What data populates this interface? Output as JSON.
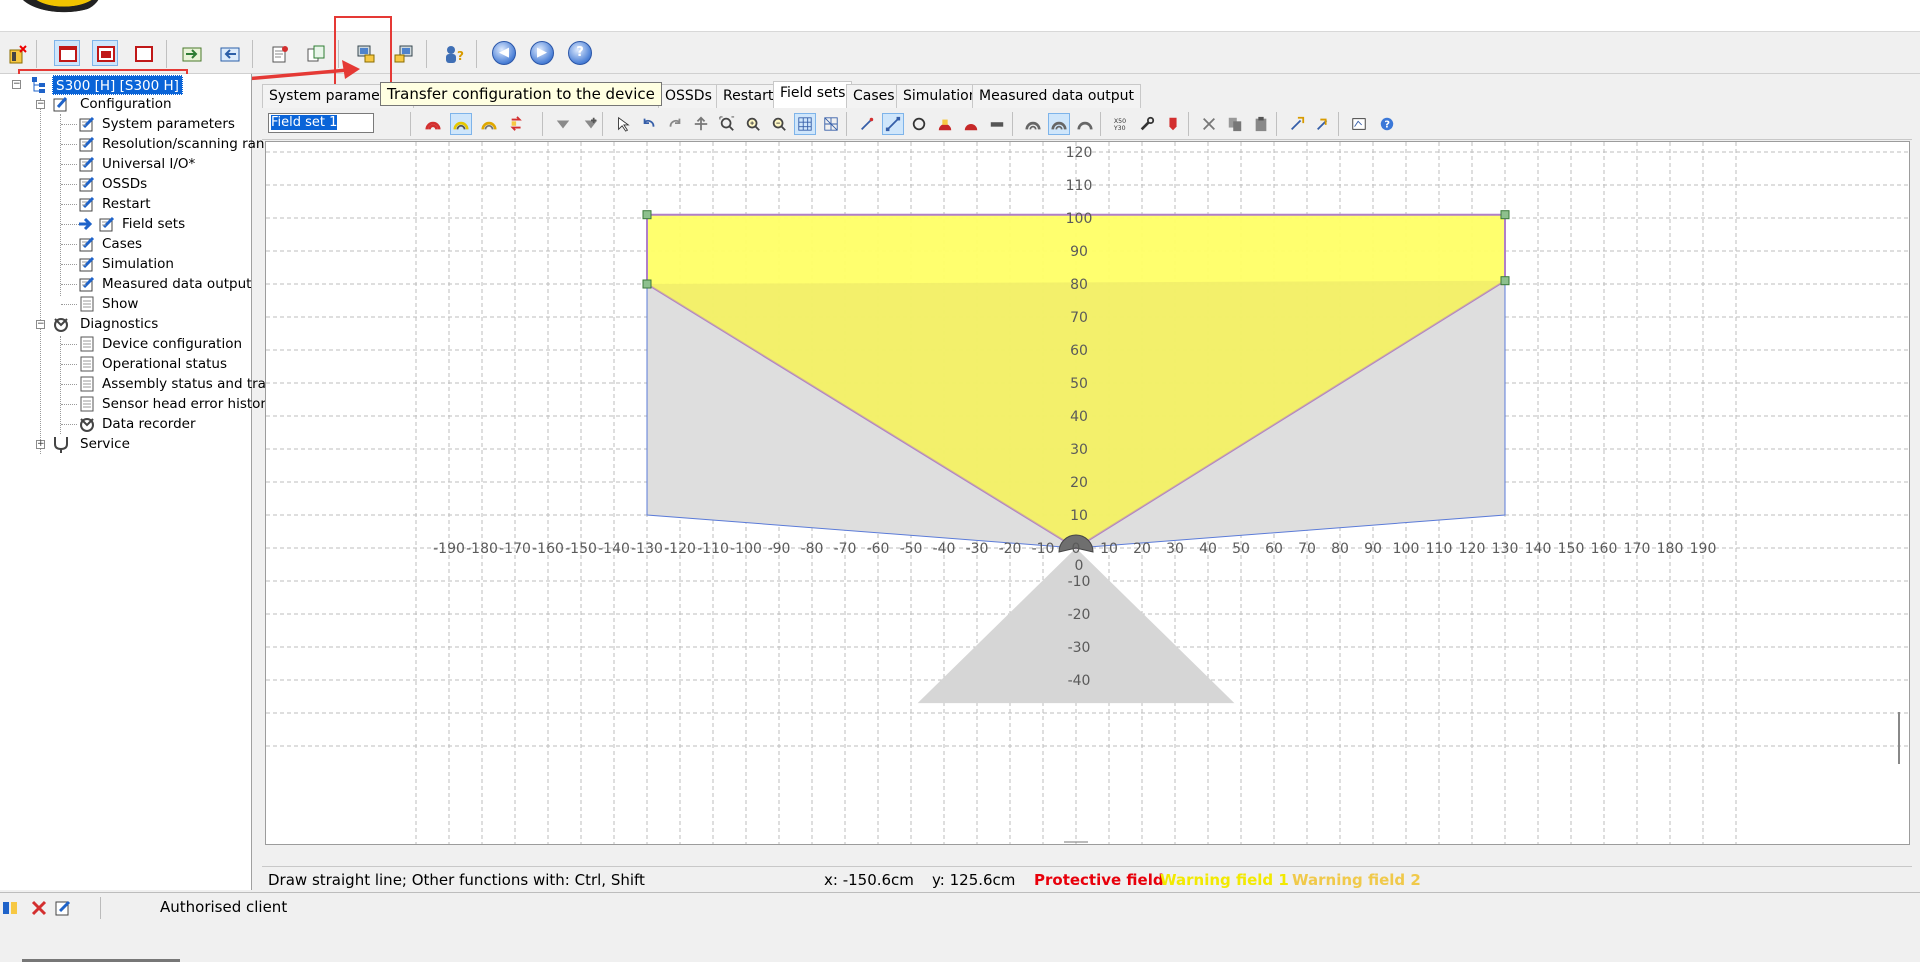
{
  "toolbar": {
    "items": [
      "new-project-icon",
      "device-window-1-icon",
      "device-window-2-icon",
      "device-window-3-icon",
      "import-icon",
      "export-icon",
      "report-icon",
      "compare-config-icon",
      "transfer-to-device-icon",
      "transfer-from-device-icon",
      "user-login-icon",
      "back-icon",
      "forward-icon",
      "help-icon"
    ]
  },
  "tooltip": {
    "text": "Transfer configuration to the device"
  },
  "tree": {
    "root": "S300 [H] [S300 H]",
    "configuration": "Configuration",
    "config_items": [
      "System parameters",
      "Resolution/scanning ran",
      "Universal I/O*",
      "OSSDs",
      "Restart",
      "Field sets",
      "Cases",
      "Simulation",
      "Measured data output",
      "Show"
    ],
    "diagnostics": "Diagnostics",
    "diag_items": [
      "Device configuration",
      "Operational status",
      "Assembly status and trac",
      "Sensor head error history",
      "Data recorder"
    ],
    "service": "Service"
  },
  "tabs": [
    "System parameters",
    "OSSDs",
    "Restart",
    "Field sets",
    "Cases",
    "Simulation",
    "Measured data output"
  ],
  "active_tab": "Field sets",
  "editor": {
    "field_set_value": "Field set 1",
    "x_ticks": [
      "-190",
      "-180",
      "-170",
      "-160",
      "-150",
      "-140",
      "-130",
      "-120",
      "-110",
      "-100",
      "-90",
      "-80",
      "-70",
      "-60",
      "-50",
      "-40",
      "-30",
      "-20",
      "-10",
      "0",
      "10",
      "20",
      "30",
      "40",
      "50",
      "60",
      "70",
      "80",
      "90",
      "100",
      "110",
      "120",
      "130",
      "140",
      "150",
      "160",
      "170",
      "180",
      "190"
    ],
    "y_ticks": [
      "120",
      "110",
      "100",
      "90",
      "80",
      "70",
      "60",
      "50",
      "40",
      "30",
      "20",
      "10",
      "0",
      "-10",
      "-20",
      "-30",
      "-40"
    ],
    "colors": {
      "protective": "#e8000b",
      "warning1": "#f2e900",
      "warning2": "#f0c94a",
      "field_fill": "#ffff66",
      "scan_area": "#dcdcdc"
    }
  },
  "status": {
    "hint": "Draw straight line; Other functions with: Ctrl, Shift",
    "x": "x: -150.6cm",
    "y": "y: 125.6cm",
    "protective": "Protective field",
    "warning1": "Warning field 1",
    "warning2": "Warning field 2"
  },
  "bottom": {
    "user": "Authorised client"
  }
}
